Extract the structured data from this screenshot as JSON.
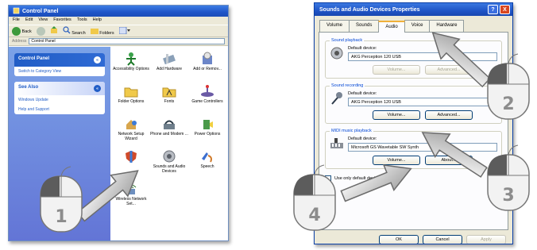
{
  "control_panel": {
    "title": "Control Panel",
    "menu": [
      "File",
      "Edit",
      "View",
      "Favorites",
      "Tools",
      "Help"
    ],
    "toolbar": {
      "back": "Back",
      "search": "Search",
      "folders": "Folders"
    },
    "address_label": "Address",
    "address_value": "Control Panel",
    "sidebar": {
      "panel_title": "Control Panel",
      "switch_view": "Switch to Category View",
      "see_also_title": "See Also",
      "links": [
        "Windows Update",
        "Help and Support"
      ]
    },
    "items": [
      {
        "label": "Accessibility Options",
        "icon": "accessibility-icon"
      },
      {
        "label": "Add Hardware",
        "icon": "hardware-icon"
      },
      {
        "label": "Add or Remov...",
        "icon": "add-remove-icon"
      },
      {
        "label": "Folder Options",
        "icon": "folder-icon"
      },
      {
        "label": "Fonts",
        "icon": "fonts-folder-icon"
      },
      {
        "label": "Game Controllers",
        "icon": "joystick-icon"
      },
      {
        "label": "Network Setup Wizard",
        "icon": "network-icon"
      },
      {
        "label": "Phone and Modem ...",
        "icon": "phone-icon"
      },
      {
        "label": "Power Options",
        "icon": "power-icon"
      },
      {
        "label": "",
        "icon": "security-icon"
      },
      {
        "label": "Sounds and Audio Devices",
        "icon": "speaker-icon"
      },
      {
        "label": "Speech",
        "icon": "speech-icon"
      },
      {
        "label": "Wireless Network Set...",
        "icon": "wireless-icon"
      }
    ]
  },
  "sounds_dialog": {
    "title": "Sounds and Audio Devices Properties",
    "help_button": "?",
    "close_button": "X",
    "tabs": [
      "Volume",
      "Sounds",
      "Audio",
      "Voice",
      "Hardware"
    ],
    "active_tab": "Audio",
    "playback": {
      "group_label": "Sound playback",
      "default_label": "Default device:",
      "device": "AKG Perception 120 USB",
      "volume_button": "Volume...",
      "advanced_button": "Advanced..."
    },
    "recording": {
      "group_label": "Sound recording",
      "default_label": "Default device:",
      "device": "AKG Perception 120 USB",
      "volume_button": "Volume...",
      "advanced_button": "Advanced..."
    },
    "midi": {
      "group_label": "MIDI music playback",
      "default_label": "Default device:",
      "device": "Microsoft GS Wavetable SW Synth",
      "volume_button": "Volume...",
      "about_button": "About..."
    },
    "use_only_default": "Use only default devices",
    "ok_button": "OK",
    "cancel_button": "Cancel",
    "apply_button": "Apply"
  },
  "steps": [
    "1",
    "2",
    "3",
    "4"
  ],
  "colors": {
    "xp_blue": "#1f55c8",
    "dialog_bg": "#ece9d8",
    "sidebar_blue": "#6f8fe0",
    "mouse_gray": "#9a9a9a"
  }
}
